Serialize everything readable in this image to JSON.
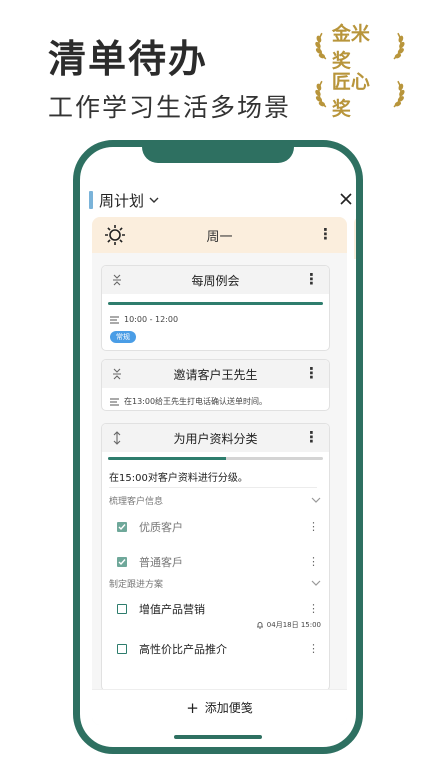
{
  "promo": {
    "headline": "清单待办",
    "subline": "工作学习生活多场景",
    "awards": [
      "金米奖",
      "匠心奖"
    ]
  },
  "colors": {
    "accent": "#2e7061",
    "award_gold": "#b8953b",
    "day_header_bg": "#fbeedd",
    "tag_blue": "#4a9de6"
  },
  "app": {
    "header": {
      "title": "周计划",
      "dropdown_icon": "chevron-down-icon",
      "close_icon": "close-icon"
    },
    "day": {
      "name": "周一",
      "icon": "sun-icon"
    },
    "notes": [
      {
        "title": "每周例会",
        "time": "10:00 - 12:00",
        "tag": "常规"
      },
      {
        "title": "邀请客户王先生",
        "description": "在13:00给王先生打电话确认送单时间。"
      },
      {
        "title": "为用户资料分类",
        "progress": 0.55,
        "description": "在15:00对客户资料进行分级。",
        "groups": [
          {
            "name": "梳理客户信息",
            "tasks": [
              {
                "label": "优质客户",
                "checked": true
              },
              {
                "label": "普通客戶",
                "checked": true
              }
            ]
          },
          {
            "name": "制定跟进方案",
            "tasks": [
              {
                "label": "增值产品营销",
                "checked": false,
                "reminder": "04月18日 15:00"
              },
              {
                "label": "高性价比产品推介",
                "checked": false
              }
            ]
          }
        ]
      }
    ],
    "add_label": "添加便笺"
  }
}
